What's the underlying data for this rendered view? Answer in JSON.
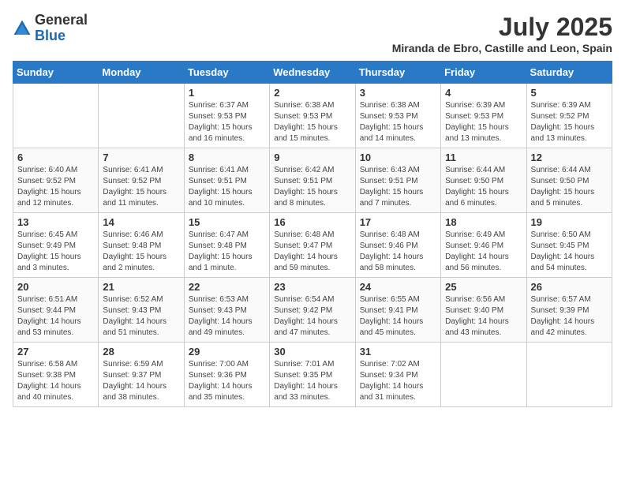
{
  "logo": {
    "general": "General",
    "blue": "Blue"
  },
  "title": {
    "month_year": "July 2025",
    "location": "Miranda de Ebro, Castille and Leon, Spain"
  },
  "days_of_week": [
    "Sunday",
    "Monday",
    "Tuesday",
    "Wednesday",
    "Thursday",
    "Friday",
    "Saturday"
  ],
  "weeks": [
    [
      {
        "day": "",
        "info": ""
      },
      {
        "day": "",
        "info": ""
      },
      {
        "day": "1",
        "info": "Sunrise: 6:37 AM\nSunset: 9:53 PM\nDaylight: 15 hours and 16 minutes."
      },
      {
        "day": "2",
        "info": "Sunrise: 6:38 AM\nSunset: 9:53 PM\nDaylight: 15 hours and 15 minutes."
      },
      {
        "day": "3",
        "info": "Sunrise: 6:38 AM\nSunset: 9:53 PM\nDaylight: 15 hours and 14 minutes."
      },
      {
        "day": "4",
        "info": "Sunrise: 6:39 AM\nSunset: 9:53 PM\nDaylight: 15 hours and 13 minutes."
      },
      {
        "day": "5",
        "info": "Sunrise: 6:39 AM\nSunset: 9:52 PM\nDaylight: 15 hours and 13 minutes."
      }
    ],
    [
      {
        "day": "6",
        "info": "Sunrise: 6:40 AM\nSunset: 9:52 PM\nDaylight: 15 hours and 12 minutes."
      },
      {
        "day": "7",
        "info": "Sunrise: 6:41 AM\nSunset: 9:52 PM\nDaylight: 15 hours and 11 minutes."
      },
      {
        "day": "8",
        "info": "Sunrise: 6:41 AM\nSunset: 9:51 PM\nDaylight: 15 hours and 10 minutes."
      },
      {
        "day": "9",
        "info": "Sunrise: 6:42 AM\nSunset: 9:51 PM\nDaylight: 15 hours and 8 minutes."
      },
      {
        "day": "10",
        "info": "Sunrise: 6:43 AM\nSunset: 9:51 PM\nDaylight: 15 hours and 7 minutes."
      },
      {
        "day": "11",
        "info": "Sunrise: 6:44 AM\nSunset: 9:50 PM\nDaylight: 15 hours and 6 minutes."
      },
      {
        "day": "12",
        "info": "Sunrise: 6:44 AM\nSunset: 9:50 PM\nDaylight: 15 hours and 5 minutes."
      }
    ],
    [
      {
        "day": "13",
        "info": "Sunrise: 6:45 AM\nSunset: 9:49 PM\nDaylight: 15 hours and 3 minutes."
      },
      {
        "day": "14",
        "info": "Sunrise: 6:46 AM\nSunset: 9:48 PM\nDaylight: 15 hours and 2 minutes."
      },
      {
        "day": "15",
        "info": "Sunrise: 6:47 AM\nSunset: 9:48 PM\nDaylight: 15 hours and 1 minute."
      },
      {
        "day": "16",
        "info": "Sunrise: 6:48 AM\nSunset: 9:47 PM\nDaylight: 14 hours and 59 minutes."
      },
      {
        "day": "17",
        "info": "Sunrise: 6:48 AM\nSunset: 9:46 PM\nDaylight: 14 hours and 58 minutes."
      },
      {
        "day": "18",
        "info": "Sunrise: 6:49 AM\nSunset: 9:46 PM\nDaylight: 14 hours and 56 minutes."
      },
      {
        "day": "19",
        "info": "Sunrise: 6:50 AM\nSunset: 9:45 PM\nDaylight: 14 hours and 54 minutes."
      }
    ],
    [
      {
        "day": "20",
        "info": "Sunrise: 6:51 AM\nSunset: 9:44 PM\nDaylight: 14 hours and 53 minutes."
      },
      {
        "day": "21",
        "info": "Sunrise: 6:52 AM\nSunset: 9:43 PM\nDaylight: 14 hours and 51 minutes."
      },
      {
        "day": "22",
        "info": "Sunrise: 6:53 AM\nSunset: 9:43 PM\nDaylight: 14 hours and 49 minutes."
      },
      {
        "day": "23",
        "info": "Sunrise: 6:54 AM\nSunset: 9:42 PM\nDaylight: 14 hours and 47 minutes."
      },
      {
        "day": "24",
        "info": "Sunrise: 6:55 AM\nSunset: 9:41 PM\nDaylight: 14 hours and 45 minutes."
      },
      {
        "day": "25",
        "info": "Sunrise: 6:56 AM\nSunset: 9:40 PM\nDaylight: 14 hours and 43 minutes."
      },
      {
        "day": "26",
        "info": "Sunrise: 6:57 AM\nSunset: 9:39 PM\nDaylight: 14 hours and 42 minutes."
      }
    ],
    [
      {
        "day": "27",
        "info": "Sunrise: 6:58 AM\nSunset: 9:38 PM\nDaylight: 14 hours and 40 minutes."
      },
      {
        "day": "28",
        "info": "Sunrise: 6:59 AM\nSunset: 9:37 PM\nDaylight: 14 hours and 38 minutes."
      },
      {
        "day": "29",
        "info": "Sunrise: 7:00 AM\nSunset: 9:36 PM\nDaylight: 14 hours and 35 minutes."
      },
      {
        "day": "30",
        "info": "Sunrise: 7:01 AM\nSunset: 9:35 PM\nDaylight: 14 hours and 33 minutes."
      },
      {
        "day": "31",
        "info": "Sunrise: 7:02 AM\nSunset: 9:34 PM\nDaylight: 14 hours and 31 minutes."
      },
      {
        "day": "",
        "info": ""
      },
      {
        "day": "",
        "info": ""
      }
    ]
  ]
}
